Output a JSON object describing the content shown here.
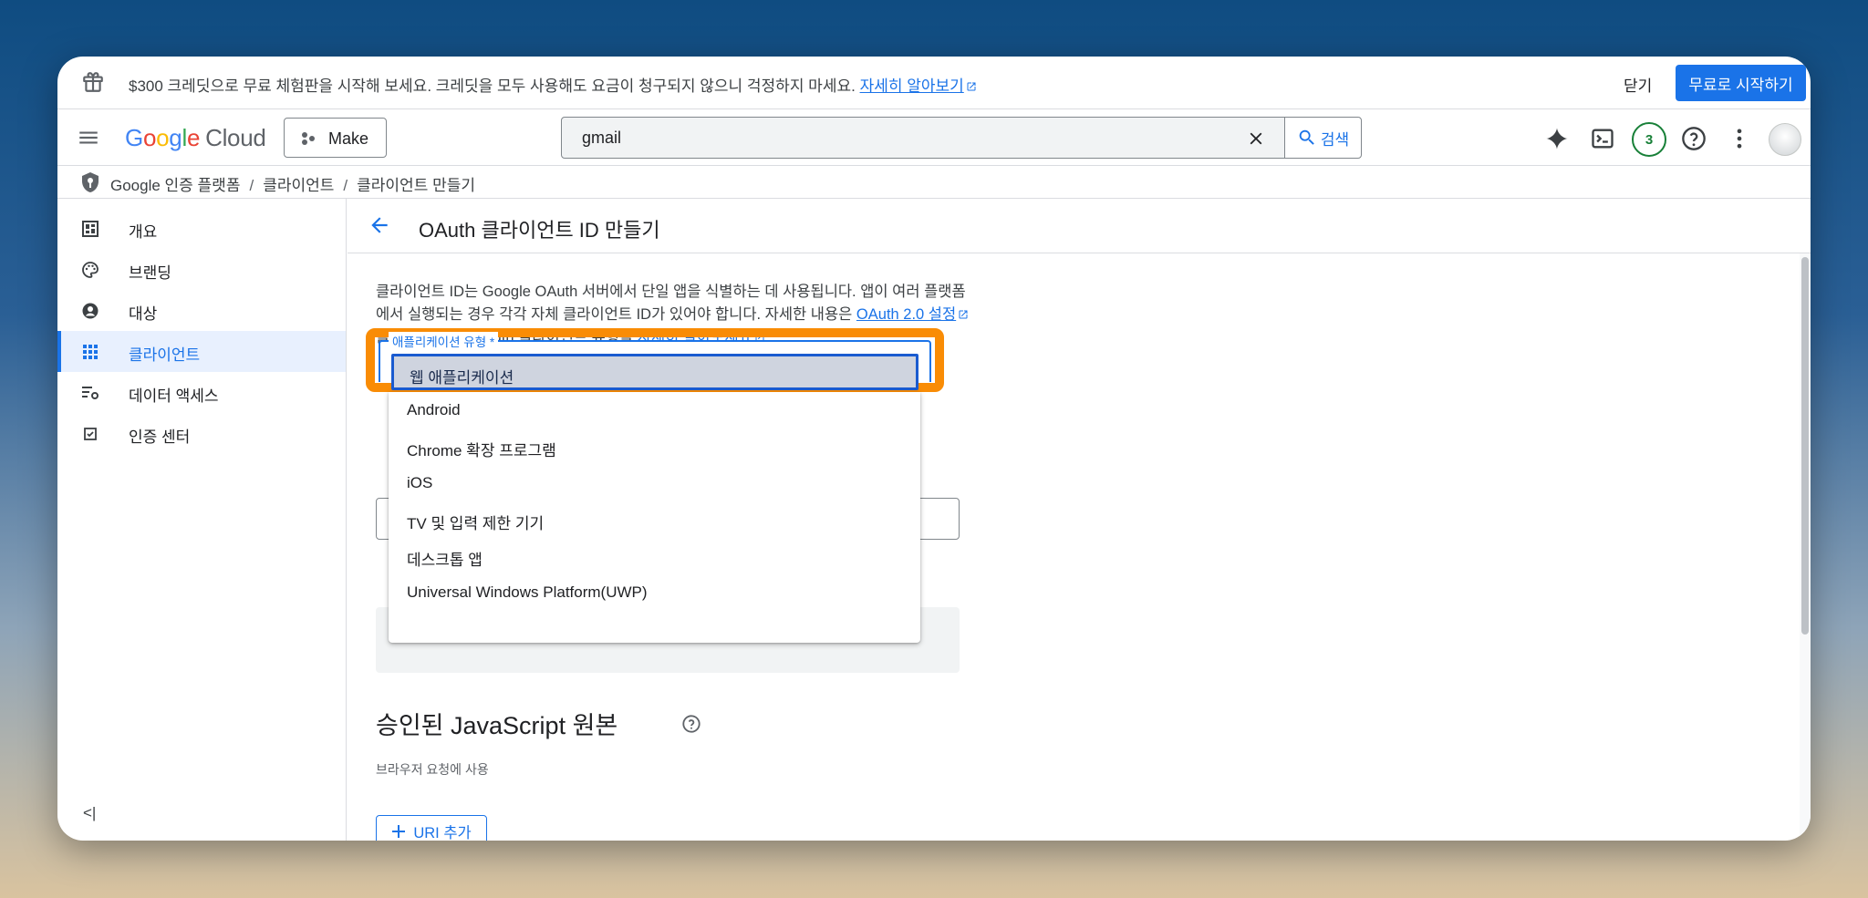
{
  "promo": {
    "text": "$300 크레딧으로 무료 체험판을 시작해 보세요. 크레딧을 모두 사용해도 요금이 청구되지 않으니 걱정하지 마세요.",
    "link": "자세히 알아보기",
    "close_label": "닫기",
    "start_label": "무료로 시작하기"
  },
  "header": {
    "logo_google": [
      "G",
      "o",
      "o",
      "g",
      "l",
      "e"
    ],
    "logo_cloud": "Cloud",
    "project_label": "Make",
    "search_value": "gmail",
    "search_button": "검색",
    "notification_count": "3"
  },
  "breadcrumb": {
    "items": [
      "Google 인증 플랫폼",
      "클라이언트",
      "클라이언트 만들기"
    ],
    "separator": "/"
  },
  "sidebar": {
    "items": [
      {
        "label": "개요",
        "icon": "dashboard-icon"
      },
      {
        "label": "브랜딩",
        "icon": "palette-icon"
      },
      {
        "label": "대상",
        "icon": "account-circle-icon"
      },
      {
        "label": "클라이언트",
        "icon": "apps-grid-icon",
        "active": true
      },
      {
        "label": "데이터 액세스",
        "icon": "data-settings-icon"
      },
      {
        "label": "인증 센터",
        "icon": "checkbox-icon"
      }
    ],
    "collapse_label": "<|"
  },
  "main": {
    "title": "OAuth 클라이언트 ID 만들기",
    "desc_part1": "클라이언트 ID는 Google OAuth 서버에서 단일 앱을 식별하는 데 사용됩니다. 앱이 여러 플랫폼에서 실행되는 경우 각각 자체 클라이언트 ID가 있어야 합니다. 자세한 내용은 ",
    "desc_link1": "OAuth 2.0 설정",
    "desc_part2": "을 참조하세요. OAuth 클라이언트 유형을 ",
    "desc_link2": "자세히 알아보세요",
    "desc_part3": ".",
    "select_label": "애플리케이션 유형 *",
    "selected_option": "웹 애플리케이션",
    "options": [
      "Android",
      "Chrome 확장 프로그램",
      "iOS",
      "TV 및 입력 제한 기기",
      "데스크톱 앱",
      "Universal Windows Platform(UWP)"
    ],
    "section_title": "승인된 JavaScript 원본",
    "section_sub": "브라우저 요청에 사용",
    "uri_button": "URI 추가"
  },
  "colors": {
    "accent": "#1a73e8",
    "highlight": "#f98c05",
    "badge": "#188038"
  }
}
